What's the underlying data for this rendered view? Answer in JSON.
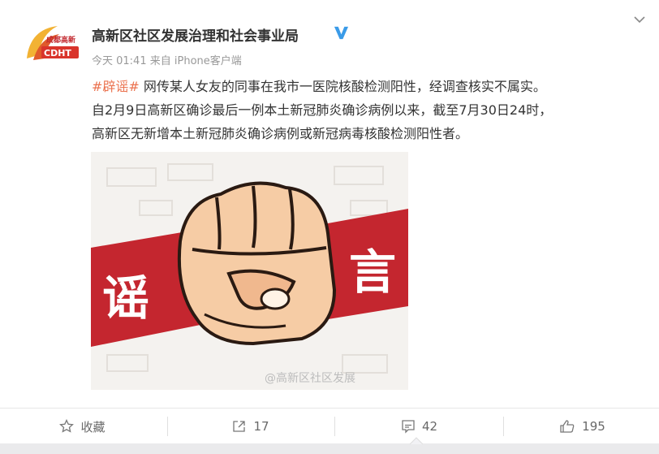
{
  "post": {
    "author": {
      "name": "高新区社区发展治理和社会事业局",
      "avatar_text_top": "成都高新",
      "avatar_text_bottom": "CDHT",
      "verified": true
    },
    "timestamp": "今天 01:41",
    "source": "来自 iPhone客户端",
    "hashtag": "#辟谣#",
    "body_line_1": " 网传某人女友的同事在我市一医院核酸检测阳性，经调查核实不属实。",
    "body_line_2": "自2月9日高新区确诊最后一例本土新冠肺炎确诊病例以来，截至7月30日24时，",
    "body_line_3": "高新区无新增本土新冠肺炎确诊病例或新冠病毒核酸检测阳性者。",
    "image": {
      "left_char": "谣",
      "right_char": "言",
      "watermark": "@高新区社区发展"
    }
  },
  "actions": {
    "favorite_label": "收藏",
    "repost_count": "17",
    "comment_count": "42",
    "like_count": "195"
  },
  "colors": {
    "hashtag": "#eb7350",
    "banner_red": "#c4262f",
    "verified_blue": "#3a9be8"
  },
  "icons": [
    "chevron-down-icon",
    "verified-icon",
    "star-icon",
    "repost-icon",
    "comment-icon",
    "like-icon"
  ]
}
